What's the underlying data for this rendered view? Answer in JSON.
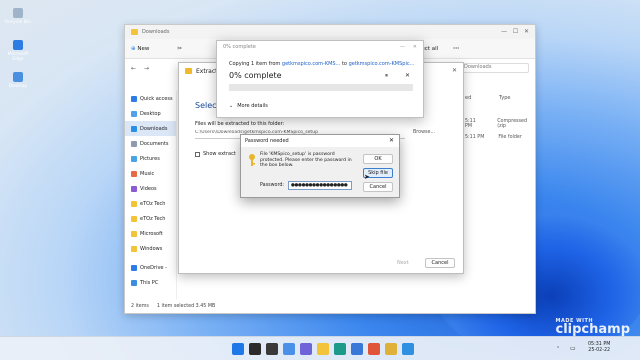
{
  "desktop": {
    "icons": [
      {
        "label": "Recycle Bin",
        "icon": "recycle-bin-icon",
        "color": "#9fb4c9"
      },
      {
        "label": "Microsoft Edge",
        "icon": "edge-icon",
        "color": "#2b7de3"
      },
      {
        "label": "Desktop",
        "icon": "desktop-icon",
        "color": "#4b8fe0"
      }
    ]
  },
  "explorer": {
    "title": "Downloads",
    "toolbar": {
      "new": "New",
      "select_all": "Select all",
      "more": "···"
    },
    "nav": {
      "back": "←",
      "forward": "→",
      "up": "↑",
      "refresh": "⟳",
      "close": "✕"
    },
    "columns": {
      "name": "Downloads",
      "date": "ed",
      "type": "Type"
    },
    "right_rows": [
      {
        "date": "5:11 PM",
        "type": "Compressed (zip"
      },
      {
        "date": "5:11 PM",
        "type": "File folder"
      }
    ],
    "sidebar": [
      {
        "label": "Quick access",
        "icon": "star-icon",
        "color": "#2d7be6",
        "active": false
      },
      {
        "label": "Desktop",
        "icon": "desktop-icon",
        "color": "#4fa0ee",
        "active": false
      },
      {
        "label": "Downloads",
        "icon": "download-icon",
        "color": "#2b8fe8",
        "active": true
      },
      {
        "label": "Documents",
        "icon": "document-icon",
        "color": "#8c9bb0",
        "active": false
      },
      {
        "label": "Pictures",
        "icon": "picture-icon",
        "color": "#47a4e6",
        "active": false
      },
      {
        "label": "Music",
        "icon": "music-icon",
        "color": "#e86a44",
        "active": false
      },
      {
        "label": "Videos",
        "icon": "video-icon",
        "color": "#8b5bd6",
        "active": false
      },
      {
        "label": "eTOz Tech",
        "icon": "folder-icon",
        "color": "#f3c33a",
        "active": false
      },
      {
        "label": "eTOz Tech",
        "icon": "folder-icon",
        "color": "#f3c33a",
        "active": false
      },
      {
        "label": "Microsoft",
        "icon": "folder-icon",
        "color": "#f3c33a",
        "active": false
      },
      {
        "label": "Windows",
        "icon": "folder-icon",
        "color": "#f3c33a",
        "active": false
      },
      {
        "label": "OneDrive - ",
        "icon": "cloud-icon",
        "color": "#2d7be6",
        "active": false
      },
      {
        "label": "This PC",
        "icon": "pc-icon",
        "color": "#3b8de0",
        "active": false
      }
    ],
    "status": {
      "items": "2 items",
      "selected": "1 item selected  3.45 MB"
    }
  },
  "wizard": {
    "tab_label": "Extract",
    "heading": "Select",
    "files_label": "Files will be extracted to this folder:",
    "path": "C:\\Users\\\\Downloads\\getkmspico.com-KMSpico_setup",
    "browse": "Browse...",
    "show_label": "Show extract",
    "next": "Next",
    "cancel": "Cancel"
  },
  "copy": {
    "title": "0% complete",
    "line_prefix": "Copying 1 item from ",
    "source": "getkmspico.com-KMS...",
    "line_mid": " to ",
    "dest": "getkmspico.com-KMSpic...",
    "progress_text": "0% complete",
    "progress": 0,
    "more": "More details",
    "pause": "⏸",
    "stop": "✕",
    "minimize": "—",
    "close": "✕"
  },
  "password": {
    "title": "Password needed",
    "message": "File 'KMSpico_setup' is password protected. Please enter the password in the box below.",
    "field_label": "Password:",
    "field_value": "●●●●●●●●●●●●●●●●",
    "ok": "OK",
    "skip": "Skip file",
    "cancel": "Cancel",
    "close": "✕"
  },
  "taskbar": {
    "icons": [
      {
        "name": "start-icon",
        "color": "#1e78e8"
      },
      {
        "name": "search-icon",
        "color": "#2b2b2b"
      },
      {
        "name": "task-view-icon",
        "color": "#3a3a3a"
      },
      {
        "name": "widgets-icon",
        "color": "#4a8fe8"
      },
      {
        "name": "chat-icon",
        "color": "#6f63d9"
      },
      {
        "name": "file-explorer-icon",
        "color": "#f3c33a"
      },
      {
        "name": "edge-icon",
        "color": "#1e9a8a"
      },
      {
        "name": "store-icon",
        "color": "#3a78d8"
      },
      {
        "name": "office-icon",
        "color": "#e0553a"
      },
      {
        "name": "chrome-icon",
        "color": "#e0b13a"
      },
      {
        "name": "shield-icon",
        "color": "#2f8fe0"
      }
    ],
    "time": "05:31 PM",
    "date": "25-02-22"
  },
  "watermark": "clipchamp",
  "watermark_small": "MADE WITH"
}
